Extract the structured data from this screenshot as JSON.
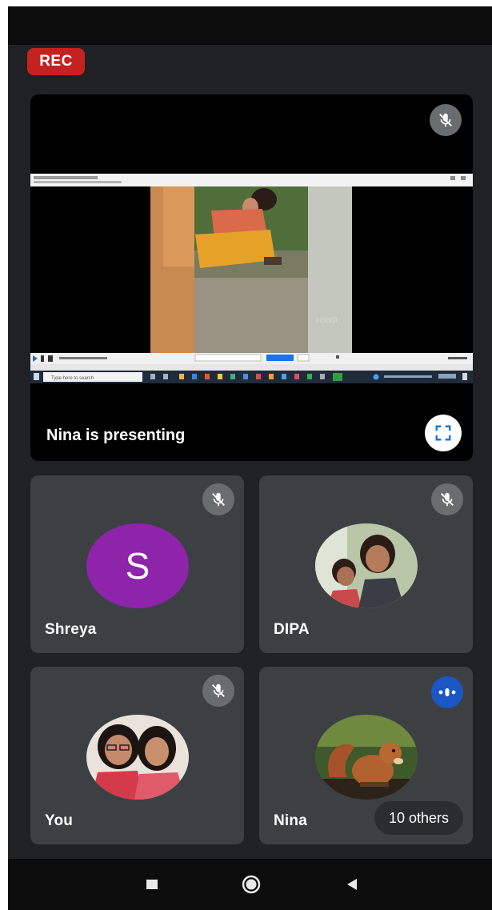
{
  "recording": {
    "label": "REC"
  },
  "presentation": {
    "presenter_label": "Nina is presenting",
    "shared_window": {
      "taskbar_search_placeholder": "Type here to search",
      "watermark": "InShOt"
    }
  },
  "participants": [
    {
      "name": "Shreya",
      "avatar_letter": "S",
      "avatar_color": "#8d24aa",
      "muted": true
    },
    {
      "name": "DIPA",
      "muted": true
    },
    {
      "name": "You",
      "muted": true
    },
    {
      "name": "Nina",
      "muted": false,
      "speaking": true
    }
  ],
  "others": {
    "label": "10 others"
  },
  "colors": {
    "background": "#202124",
    "tile": "#3c4043",
    "rec": "#c5221f",
    "speaking": "#1a56c4",
    "mute_badge": "#6a6d70"
  },
  "icons": {
    "mute": "mic-off-icon",
    "speaking": "audio-level-icon",
    "fullscreen": "fullscreen-icon",
    "nav_recents": "square-icon",
    "nav_home": "circle-icon",
    "nav_back": "triangle-back-icon"
  }
}
